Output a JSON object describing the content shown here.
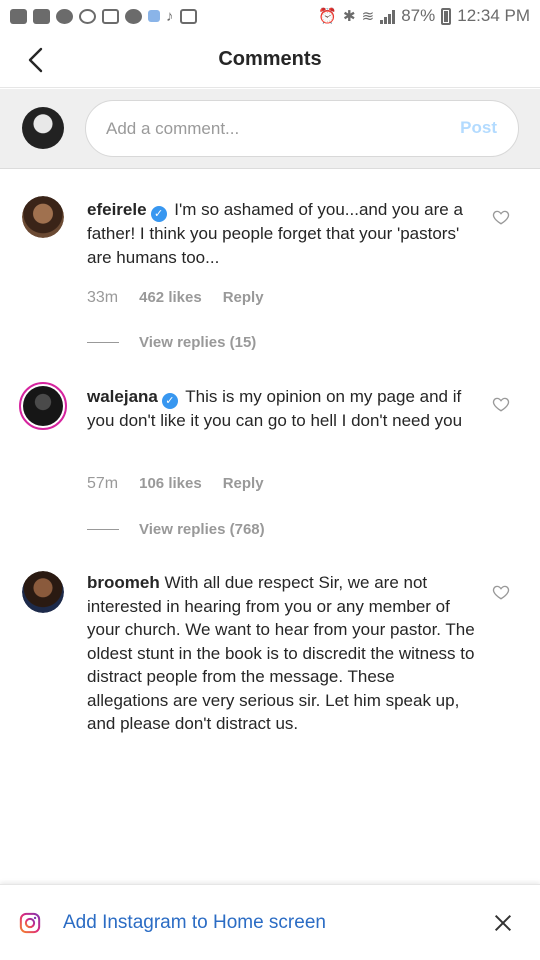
{
  "status_bar": {
    "left_icons": [
      "chat-icon",
      "mail-icon",
      "whatsapp-icon",
      "whatsapp-icon",
      "gallery-icon",
      "messenger-icon",
      "dropbox-icon",
      "music-note-icon",
      "calendar-icon"
    ],
    "battery_percent": "87%",
    "time": "12:34 PM"
  },
  "header": {
    "title": "Comments",
    "back_icon": "chevron-left-icon"
  },
  "composer": {
    "placeholder": "Add a comment...",
    "post_label": "Post",
    "post_color": "#b3dbff"
  },
  "comments": [
    {
      "username": "efeirele",
      "verified": true,
      "text": "I'm so ashamed of you...and you are a father! I think you people forget that your 'pastors' are humans too...",
      "time": "33m",
      "likes": "462 likes",
      "reply_label": "Reply",
      "view_replies": "View replies (15)"
    },
    {
      "username": "walejana",
      "verified": true,
      "text": "This is my opinion on my page and if you don't like it you can go to hell I don't need you",
      "time": "57m",
      "likes": "106 likes",
      "reply_label": "Reply",
      "view_replies": "View replies (768)"
    },
    {
      "username": "broomeh",
      "verified": false,
      "text": "With all due respect Sir, we are not interested in hearing from you or any member of your church. We want to hear from your pastor. The oldest stunt in the book is to discredit the witness to distract people from the message. These allegations are very serious sir. Let him speak up, and please don't distract us."
    }
  ],
  "banner": {
    "text": "Add Instagram to Home screen",
    "icon": "instagram-icon",
    "close_icon": "close-icon",
    "link_color": "#2b6cc4"
  }
}
